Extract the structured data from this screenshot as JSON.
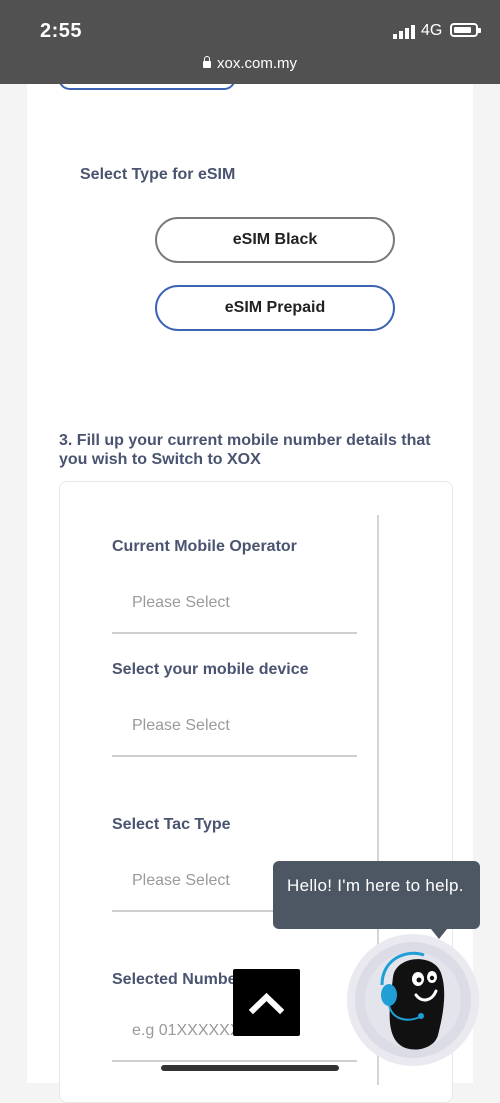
{
  "status_bar": {
    "time": "2:55",
    "network": "4G",
    "url": "xox.com.my"
  },
  "esim": {
    "heading": "Select Type for eSIM",
    "options": [
      "eSIM Black",
      "eSIM Prepaid"
    ]
  },
  "step3": {
    "heading": "3. Fill up your current mobile number details that you wish to Switch to XOX"
  },
  "form": {
    "operator_label": "Current Mobile Operator",
    "operator_value": "Please Select",
    "device_label": "Select your mobile device",
    "device_value": "Please Select",
    "tac_label": "Select Tac Type",
    "tac_value": "Please Select",
    "number_label": "Selected Numbe",
    "number_placeholder": "e.g 01XXXXXXXX"
  },
  "chat": {
    "greeting": "Hello! I'm here to help."
  },
  "colors": {
    "accent": "#3d63b5",
    "label": "#4a5470",
    "statusbar": "#515151",
    "chat_bubble": "#4d5764"
  }
}
